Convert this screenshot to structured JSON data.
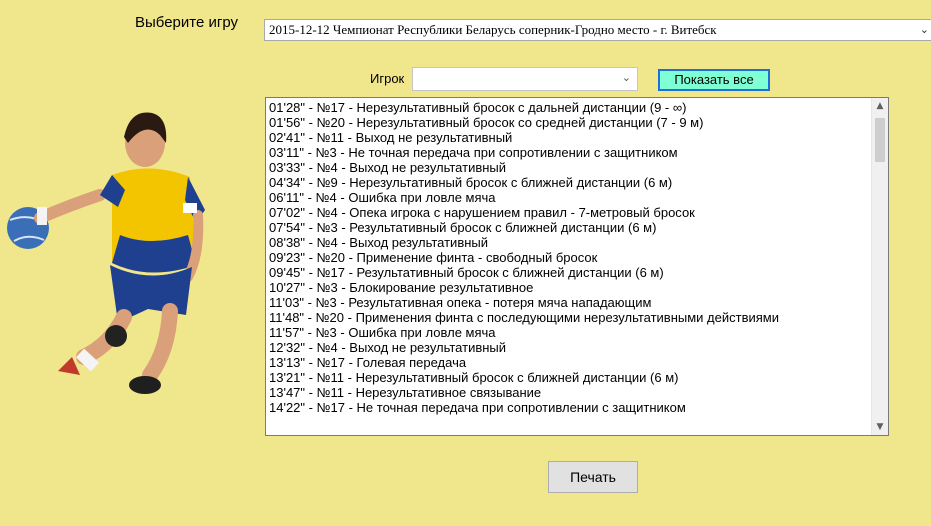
{
  "game": {
    "label": "Выберите игру",
    "selected": "2015-12-12 Чемпионат Республики Беларусь соперник-Гродно место - г. Витебск"
  },
  "player": {
    "label": "Игрок",
    "selected": ""
  },
  "show_all_label": "Показать все",
  "print_label": "Печать",
  "events": [
    "01'28\" - №17 - Нерезультативный бросок с дальней дистанции (9 - ∞)",
    "01'56\" - №20 - Нерезультативный бросок со средней дистанции (7 - 9 м)",
    "02'41\" - №11 - Выход не результативный",
    "03'11\" - №3 - Не точная передача при сопротивлении с защитником",
    "03'33\" - №4 - Выход не результативный",
    "04'34\" - №9 - Нерезультативный бросок с ближней дистанции (6 м)",
    "06'11\" - №4 - Ошибка при ловле мяча",
    "07'02\" - №4 - Опека игрока с нарушением правил - 7-метровый бросок",
    "07'54\" - №3 - Результативный бросок с ближней дистанции (6 м)",
    "08'38\" - №4 - Выход результативный",
    "09'23\" - №20 - Применение финта - свободный бросок",
    "09'45\" - №17 - Результативный бросок с ближней дистанции (6 м)",
    "10'27\" - №3 - Блокирование результативное",
    "11'03\" - №3 - Результативная опека - потеря мяча нападающим",
    "11'48\" - №20 - Применения финта с последующими нерезультативными действиями",
    "11'57\" - №3 - Ошибка при ловле мяча",
    "12'32\" - №4 - Выход не результативный",
    "13'13\" - №17 - Голевая передача",
    "13'21\" - №11 - Нерезультативный бросок с ближней дистанции (6 м)",
    "13'47\" - №11 - Нерезультативное связывание",
    "14'22\" - №17 - Не точная передача при сопротивлении с защитником"
  ],
  "icons": {
    "dropdown": "chevron-down-icon",
    "scroll_up": "scroll-up-arrow-icon",
    "scroll_down": "scroll-down-arrow-icon",
    "illustration": "handball-player-illustration"
  },
  "colors": {
    "background": "#f0e68c",
    "show_all_bg": "#7fffd4",
    "show_all_border": "#1e6fd8",
    "jersey_yellow": "#f2c500",
    "jersey_blue": "#1f3f8f"
  }
}
